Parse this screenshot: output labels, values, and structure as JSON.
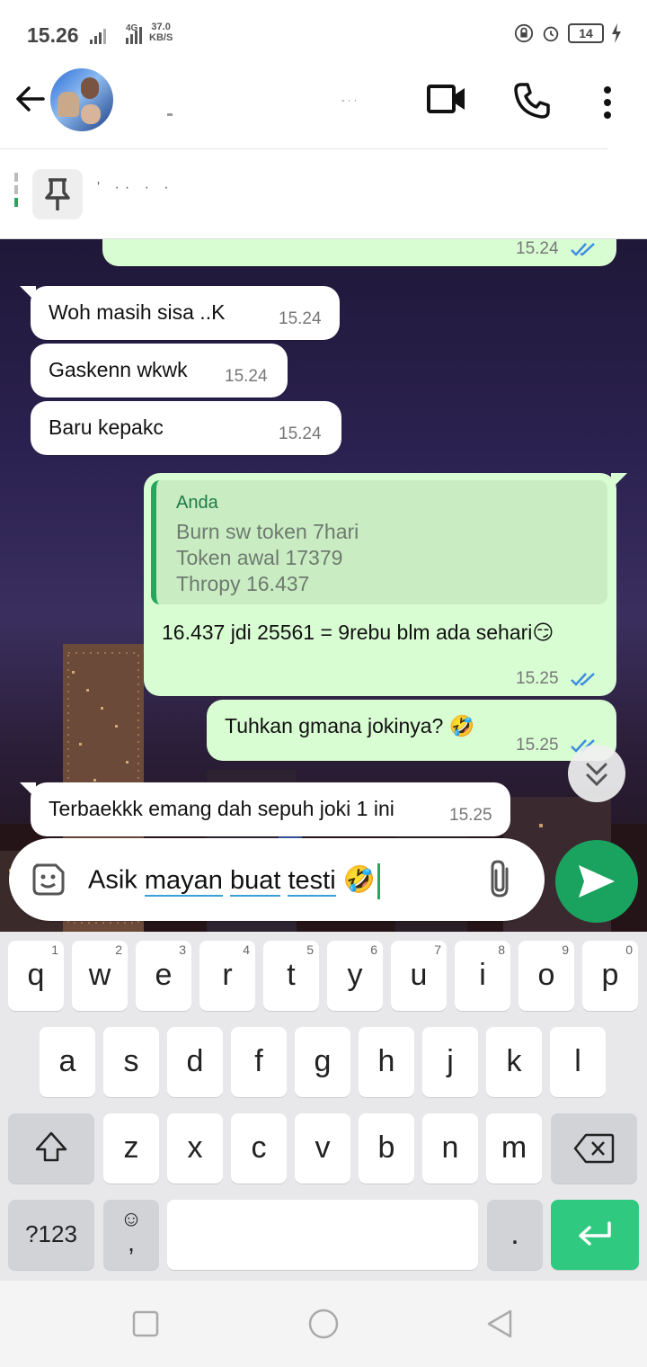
{
  "status_bar": {
    "time": "15.26",
    "network": "4G",
    "speed": "37.0",
    "speed_unit": "KB/S",
    "battery": "14"
  },
  "header": {
    "contact_name": "- · ·"
  },
  "pinned": {
    "text": "' ·· ·  ·"
  },
  "messages": [
    {
      "id": "m0",
      "direction": "out",
      "text": "",
      "time": "15.24",
      "status": "read"
    },
    {
      "id": "m1",
      "direction": "in",
      "text": "Woh masih sisa ..K",
      "time": "15.24"
    },
    {
      "id": "m2",
      "direction": "in",
      "text": "Gaskenn wkwk",
      "time": "15.24"
    },
    {
      "id": "m3",
      "direction": "in",
      "text": "Baru kepakc",
      "time": "15.24"
    },
    {
      "id": "m4",
      "direction": "out",
      "quote": {
        "author": "Anda",
        "lines": [
          "Burn sw token 7hari",
          "Token awal 17379",
          "Thropy 16.437"
        ]
      },
      "text": "16.437 jdi 25561 = 9rebu blm ada sehari😏",
      "time": "15.25",
      "status": "read"
    },
    {
      "id": "m5",
      "direction": "out",
      "text": "Tuhkan gmana jokinya? 🤣",
      "time": "15.25",
      "status": "read"
    },
    {
      "id": "m6",
      "direction": "in",
      "text": "Terbaekkk emang dah sepuh joki 1 ini",
      "time": "15.25"
    }
  ],
  "composer": {
    "word1": "Asik",
    "word2": "mayan",
    "word3": "buat",
    "word4": "testi",
    "emoji": "🤣"
  },
  "keyboard": {
    "row1": [
      {
        "key": "q",
        "hint": "1"
      },
      {
        "key": "w",
        "hint": "2"
      },
      {
        "key": "e",
        "hint": "3"
      },
      {
        "key": "r",
        "hint": "4"
      },
      {
        "key": "t",
        "hint": "5"
      },
      {
        "key": "y",
        "hint": "6"
      },
      {
        "key": "u",
        "hint": "7"
      },
      {
        "key": "i",
        "hint": "8"
      },
      {
        "key": "o",
        "hint": "9"
      },
      {
        "key": "p",
        "hint": "0"
      }
    ],
    "row2": [
      "a",
      "s",
      "d",
      "f",
      "g",
      "h",
      "j",
      "k",
      "l"
    ],
    "row3": [
      "z",
      "x",
      "c",
      "v",
      "b",
      "n",
      "m"
    ],
    "symbols": "?123",
    "comma": ",",
    "emoji_key": "☺",
    "period": "."
  },
  "colors": {
    "accent": "#1aa35e",
    "bubble_out": "#d9fdd3",
    "bubble_in": "#ffffff",
    "read_tick": "#3b8de0"
  }
}
